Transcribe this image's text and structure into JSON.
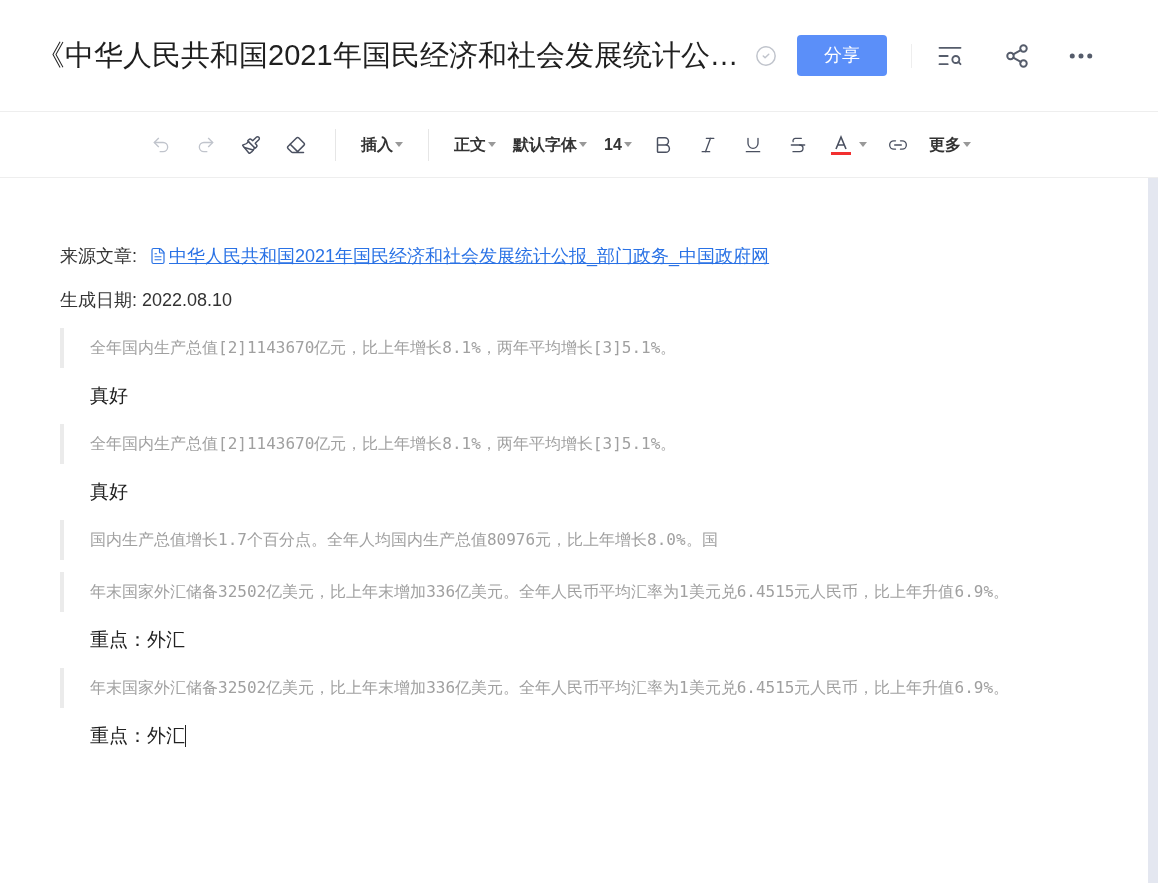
{
  "header": {
    "title": "《中华人民共和国2021年国民经济和社会发展统计公…",
    "share_button": "分享"
  },
  "toolbar": [
    {
      "kind": "undo",
      "disabled": true
    },
    {
      "kind": "redo",
      "disabled": true
    },
    {
      "kind": "painter",
      "disabled": false
    },
    {
      "kind": "eraser",
      "disabled": false
    },
    {
      "kind": "divider"
    },
    {
      "kind": "menu",
      "label": "插入"
    },
    {
      "kind": "divider"
    },
    {
      "kind": "menu",
      "label": "正文"
    },
    {
      "kind": "menu",
      "label": "默认字体"
    },
    {
      "kind": "menu",
      "label": "14"
    },
    {
      "kind": "bold",
      "disabled": false
    },
    {
      "kind": "italic",
      "disabled": false
    },
    {
      "kind": "underline",
      "disabled": false
    },
    {
      "kind": "strike",
      "disabled": false
    },
    {
      "kind": "fontcolor",
      "disabled": false
    },
    {
      "kind": "link",
      "disabled": false
    },
    {
      "kind": "menu",
      "label": "更多"
    }
  ],
  "document": {
    "source_label": "来源文章:",
    "source_link": "中华人民共和国2021年国民经济和社会发展统计公报_部门政务_中国政府网",
    "date_label": "生成日期: 2022.08.10",
    "blocks": [
      {
        "kind": "quote",
        "text": "全年国内生产总值[2]1143670亿元，比上年增长8.1%，两年平均增长[3]5.1%。"
      },
      {
        "kind": "note",
        "text": "真好"
      },
      {
        "kind": "quote",
        "text": "全年国内生产总值[2]1143670亿元，比上年增长8.1%，两年平均增长[3]5.1%。"
      },
      {
        "kind": "note",
        "text": "真好"
      },
      {
        "kind": "quote",
        "text": "国内生产总值增长1.7个百分点。全年人均国内生产总值80976元，比上年增长8.0%。国"
      },
      {
        "kind": "quote",
        "text": "年末国家外汇储备32502亿美元，比上年末增加336亿美元。全年人民币平均汇率为1美元兑6.4515元人民币，比上年升值6.9%。"
      },
      {
        "kind": "note",
        "text": "重点：外汇"
      },
      {
        "kind": "quote",
        "text": "年末国家外汇储备32502亿美元，比上年末增加336亿美元。全年人民币平均汇率为1美元兑6.4515元人民币，比上年升值6.9%。"
      },
      {
        "kind": "note",
        "text": "重点：外汇",
        "cursor": true
      }
    ]
  }
}
